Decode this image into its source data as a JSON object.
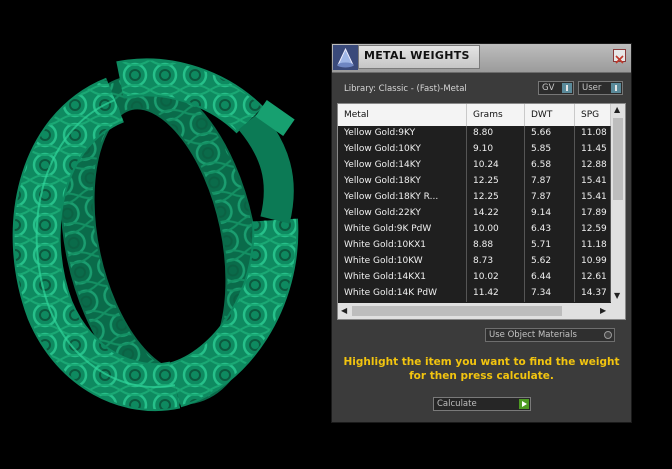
{
  "window": {
    "title": "METAL WEIGHTS"
  },
  "library": {
    "label": "Library: Classic - (Fast)-Metal"
  },
  "toggles": {
    "gv": "GV",
    "user": "User"
  },
  "table": {
    "columns": [
      "Metal",
      "Grams",
      "DWT",
      "SPG"
    ],
    "rows": [
      [
        "Yellow Gold:9KY",
        "8.80",
        "5.66",
        "11.08"
      ],
      [
        "Yellow Gold:10KY",
        "9.10",
        "5.85",
        "11.45"
      ],
      [
        "Yellow Gold:14KY",
        "10.24",
        "6.58",
        "12.88"
      ],
      [
        "Yellow Gold:18KY",
        "12.25",
        "7.87",
        "15.41"
      ],
      [
        "Yellow Gold:18KY R...",
        "12.25",
        "7.87",
        "15.41"
      ],
      [
        "Yellow Gold:22KY",
        "14.22",
        "9.14",
        "17.89"
      ],
      [
        "White Gold:9K PdW",
        "10.00",
        "6.43",
        "12.59"
      ],
      [
        "White Gold:10KX1",
        "8.88",
        "5.71",
        "11.18"
      ],
      [
        "White Gold:10KW",
        "8.73",
        "5.62",
        "10.99"
      ],
      [
        "White Gold:14KX1",
        "10.02",
        "6.44",
        "12.61"
      ],
      [
        "White Gold:14K PdW",
        "11.42",
        "7.34",
        "14.37"
      ]
    ]
  },
  "options": {
    "use_object_materials": "Use Object Materials"
  },
  "instructions": {
    "line1": "Highlight the item you want to find the weight",
    "line2": "for then press calculate."
  },
  "calculate": {
    "label": "Calculate"
  },
  "colors": {
    "ring": "#0e8a60",
    "highlight_text": "#f2c40f",
    "panel_bg": "#3b3b3b"
  }
}
